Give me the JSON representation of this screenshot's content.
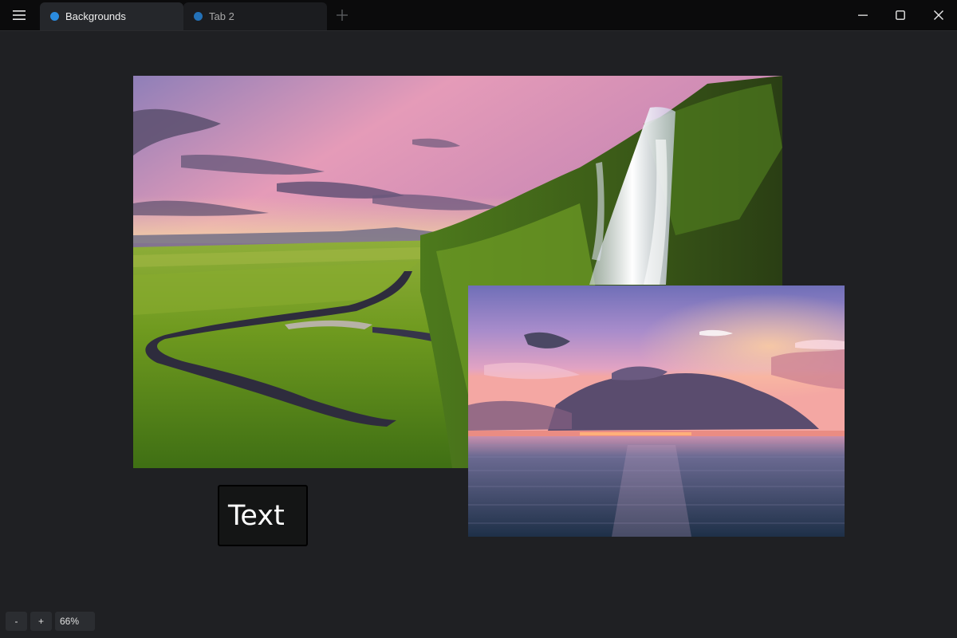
{
  "tabs": [
    {
      "label": "Backgrounds",
      "dot_color": "#2b8ce0",
      "active": true
    },
    {
      "label": "Tab 2",
      "dot_color": "#2371b8",
      "active": false
    }
  ],
  "canvas": {
    "images": [
      {
        "name": "landscape-waterfall-image",
        "subject": "green valley with waterfall at sunset"
      },
      {
        "name": "ocean-sunset-image",
        "subject": "ocean with pink sunset clouds"
      }
    ],
    "text_element": {
      "text": "Text"
    }
  },
  "zoom": {
    "minus_label": "-",
    "plus_label": "+",
    "level": "66%"
  },
  "icons": {
    "menu": "hamburger-menu-icon",
    "add_tab": "plus-icon",
    "minimize": "minimize-icon",
    "maximize": "maximize-icon",
    "close": "close-icon"
  },
  "colors": {
    "titlebar": "#0b0b0c",
    "canvas_bg": "#1f2023",
    "tab_active": "#25272b",
    "accent": "#2b8ce0"
  }
}
